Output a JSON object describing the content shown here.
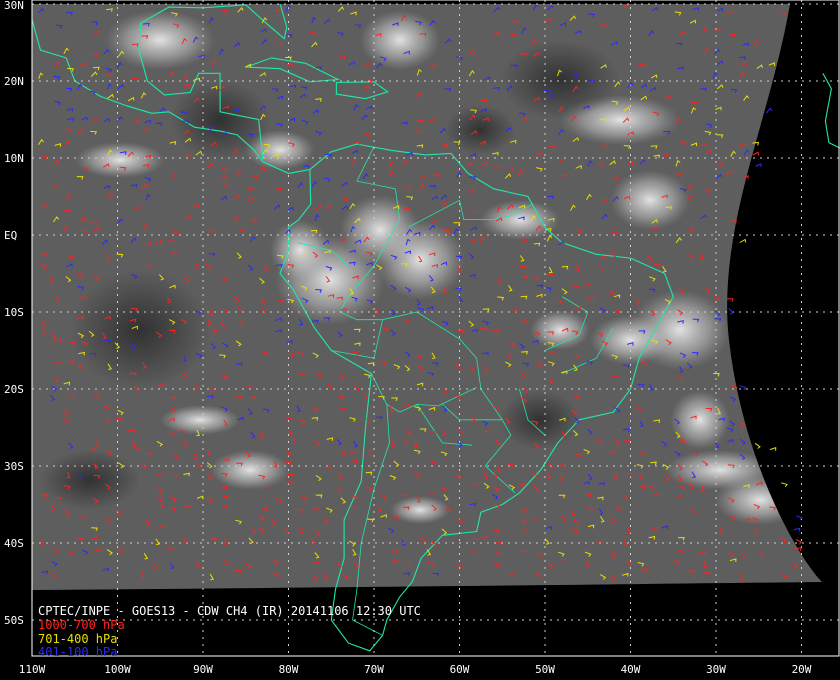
{
  "title": "CPTEC/INPE - GOES13 - CDW CH4 (IR) 20141106 12:30 UTC",
  "legend": [
    {
      "label": "1000-700 hPa",
      "color": "#ff2222"
    },
    {
      "label": "701-400 hPa",
      "color": "#e8e000"
    },
    {
      "label": "401-100 hPa",
      "color": "#2a2aff"
    }
  ],
  "colors": {
    "coastline": "#20e8a8",
    "grid": "#d0d0d0",
    "background": "#000000"
  },
  "grid": {
    "latitudes": [
      {
        "value": 30,
        "label": "30N"
      },
      {
        "value": 20,
        "label": "20N"
      },
      {
        "value": 10,
        "label": "10N"
      },
      {
        "value": 0,
        "label": "EQ"
      },
      {
        "value": -10,
        "label": "10S"
      },
      {
        "value": -20,
        "label": "20S"
      },
      {
        "value": -30,
        "label": "30S"
      },
      {
        "value": -40,
        "label": "40S"
      },
      {
        "value": -50,
        "label": "50S"
      }
    ],
    "longitudes": [
      {
        "value": -110,
        "label": "110W"
      },
      {
        "value": -100,
        "label": "100W"
      },
      {
        "value": -90,
        "label": "90W"
      },
      {
        "value": -80,
        "label": "80W"
      },
      {
        "value": -70,
        "label": "70W"
      },
      {
        "value": -60,
        "label": "60W"
      },
      {
        "value": -50,
        "label": "50W"
      },
      {
        "value": -40,
        "label": "40W"
      },
      {
        "value": -30,
        "label": "30W"
      },
      {
        "value": -20,
        "label": "20W"
      }
    ]
  }
}
